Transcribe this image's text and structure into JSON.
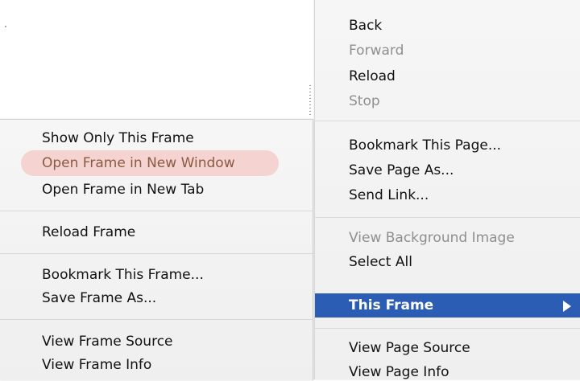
{
  "main_menu": {
    "back": "Back",
    "forward": "Forward",
    "reload": "Reload",
    "stop": "Stop",
    "bookmark_page": "Bookmark This Page...",
    "save_page_as": "Save Page As...",
    "send_link": "Send Link...",
    "view_background_image": "View Background Image",
    "select_all": "Select All",
    "this_frame": "This Frame",
    "view_page_source": "View Page Source",
    "view_page_info": "View Page Info"
  },
  "frame_menu": {
    "show_only_this_frame": "Show Only This Frame",
    "open_frame_new_window": "Open Frame in New Window",
    "open_frame_new_tab": "Open Frame in New Tab",
    "reload_frame": "Reload Frame",
    "bookmark_this_frame": "Bookmark This Frame...",
    "save_frame_as": "Save Frame As...",
    "view_frame_source": "View Frame Source",
    "view_frame_info": "View Frame Info"
  },
  "colors": {
    "selection": "#2a5db3",
    "highlight": "#f5d3d1",
    "disabled_text": "#8f8f8f"
  }
}
